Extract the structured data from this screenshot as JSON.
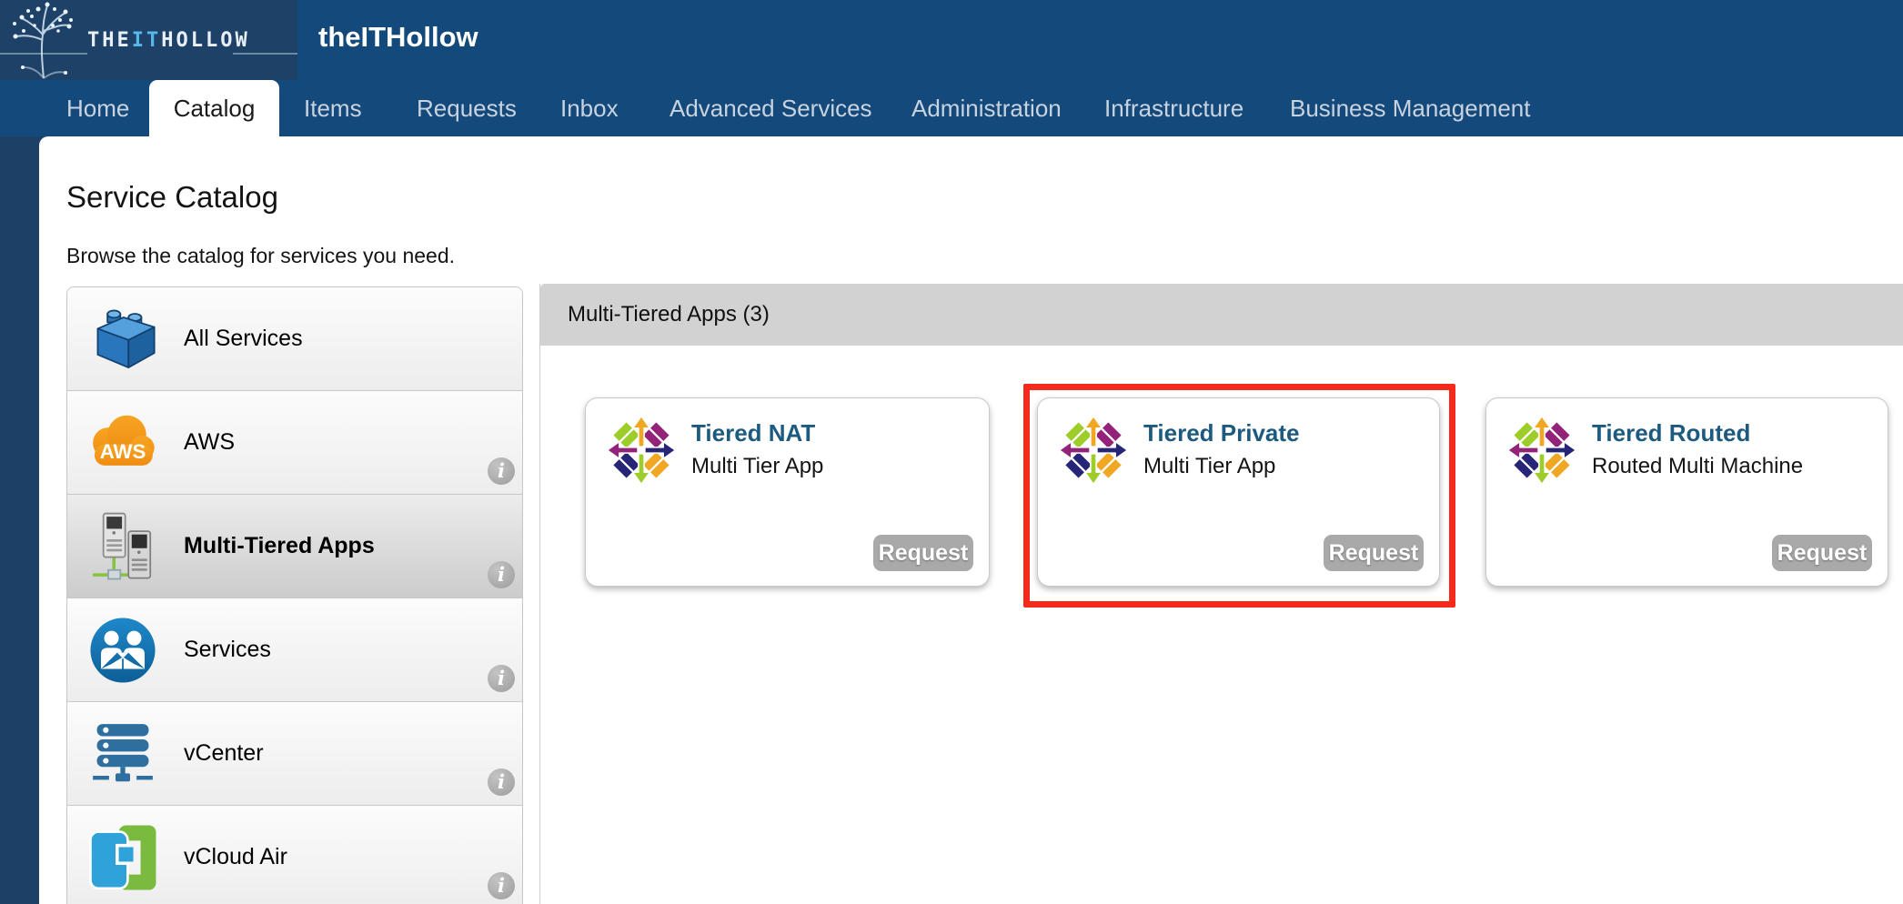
{
  "brand": {
    "logo_text_pre": "THE",
    "logo_text_it": "IT",
    "logo_text_post": "HOLLOW",
    "app_title": "theITHollow"
  },
  "nav": {
    "active": "Catalog",
    "items": [
      {
        "label": "Home"
      },
      {
        "label": "Catalog"
      },
      {
        "label": "Items"
      },
      {
        "label": "Requests"
      },
      {
        "label": "Inbox"
      },
      {
        "label": "Advanced Services"
      },
      {
        "label": "Administration"
      },
      {
        "label": "Infrastructure"
      },
      {
        "label": "Business Management"
      }
    ]
  },
  "page": {
    "title": "Service Catalog",
    "subtitle": "Browse the catalog for services you need."
  },
  "sidebar": {
    "items": [
      {
        "label": "All Services",
        "icon": "brick-icon",
        "selected": false,
        "has_info": false
      },
      {
        "label": "AWS",
        "icon": "aws-cloud-icon",
        "selected": false,
        "has_info": true
      },
      {
        "label": "Multi-Tiered Apps",
        "icon": "tiered-apps-icon",
        "selected": true,
        "has_info": true
      },
      {
        "label": "Services",
        "icon": "services-icon",
        "selected": false,
        "has_info": true
      },
      {
        "label": "vCenter",
        "icon": "vcenter-icon",
        "selected": false,
        "has_info": true
      },
      {
        "label": "vCloud Air",
        "icon": "vcloud-air-icon",
        "selected": false,
        "has_info": true
      }
    ],
    "info_glyph": "i"
  },
  "main": {
    "section_header": "Multi-Tiered Apps (3)",
    "cards": [
      {
        "title": "Tiered NAT",
        "subtitle": "Multi Tier App",
        "button": "Request",
        "icon": "centos-icon",
        "highlighted": false
      },
      {
        "title": "Tiered Private",
        "subtitle": "Multi Tier App",
        "button": "Request",
        "icon": "centos-icon",
        "highlighted": true
      },
      {
        "title": "Tiered Routed",
        "subtitle": "Routed Multi Machine",
        "button": "Request",
        "icon": "centos-icon",
        "highlighted": false
      }
    ]
  },
  "colors": {
    "header_blue": "#14497b",
    "logo_navy": "#1e4168",
    "left_strip": "#1d4166",
    "highlight_red": "#f5291c",
    "band_gray": "#d2d2d2",
    "button_gray": "#a9a9a9",
    "card_link_blue": "#1d5a80",
    "logo_it_blue": "#55b9ea",
    "centos_purple": "#932279",
    "centos_green": "#9ccd2a",
    "centos_blue": "#262577",
    "centos_orange": "#efa724"
  }
}
